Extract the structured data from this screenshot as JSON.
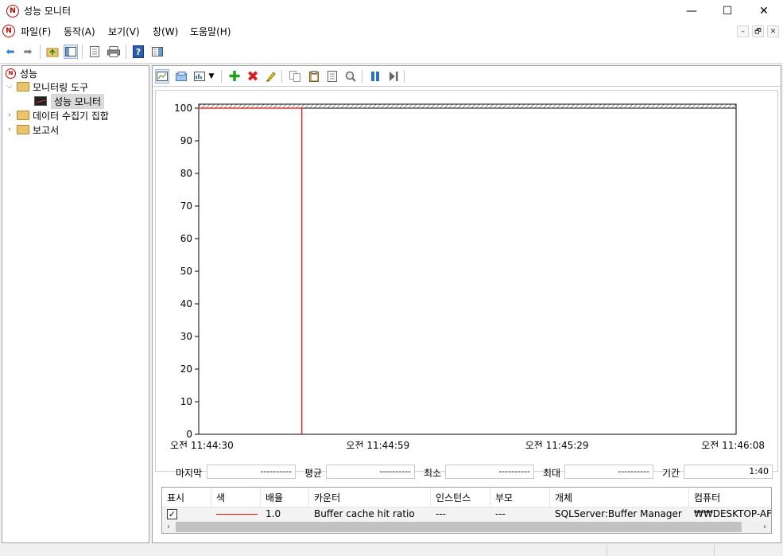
{
  "window": {
    "title": "성능 모니터",
    "minimize": "—",
    "maximize": "☐",
    "close": "✕"
  },
  "menu": {
    "items": [
      "파일(F)",
      "동작(A)",
      "보기(V)",
      "창(W)",
      "도움말(H)"
    ],
    "mdi": [
      "–",
      "🗗",
      "✕"
    ]
  },
  "tree": {
    "root": "성능",
    "tools": "모니터링 도구",
    "perfmon": "성능 모니터",
    "collector_sets": "데이터 수집기 집합",
    "reports": "보고서"
  },
  "stats": {
    "last_label": "마지막",
    "last_value": "----------",
    "avg_label": "평균",
    "avg_value": "----------",
    "min_label": "최소",
    "min_value": "----------",
    "max_label": "최대",
    "max_value": "----------",
    "duration_label": "기간",
    "duration_value": "1:40"
  },
  "table": {
    "headers": [
      "표시",
      "색",
      "배율",
      "카운터",
      "인스턴스",
      "부모",
      "개체",
      "컴퓨터"
    ],
    "rows": [
      {
        "show_checked": true,
        "color": "#ff0000",
        "scale": "1.0",
        "counter": "Buffer cache hit ratio",
        "instance": "---",
        "parent": "---",
        "object": "SQLServer:Buffer Manager",
        "computer": "₩₩DESKTOP-AFDI"
      }
    ]
  },
  "chart_data": {
    "type": "line",
    "ylim": [
      0,
      100
    ],
    "yticks": [
      0,
      10,
      20,
      30,
      40,
      50,
      60,
      70,
      80,
      90,
      100
    ],
    "xtick_labels": [
      "오전 11:44:30",
      "오전 11:44:59",
      "오전 11:45:29",
      "오전 11:46:08"
    ],
    "series": [
      {
        "color": "#ff0000",
        "x": [
          0,
          1,
          2,
          3,
          4,
          5,
          6,
          7,
          8,
          9,
          10,
          11,
          12,
          13,
          14,
          15,
          16,
          17,
          18,
          19
        ],
        "values": [
          100,
          100,
          100,
          100,
          100,
          100,
          100,
          100,
          100,
          100,
          100,
          100,
          100,
          100,
          100,
          100,
          100,
          100,
          100,
          100
        ]
      }
    ],
    "points_per_window": 100,
    "current_index": 19,
    "grid": false
  }
}
